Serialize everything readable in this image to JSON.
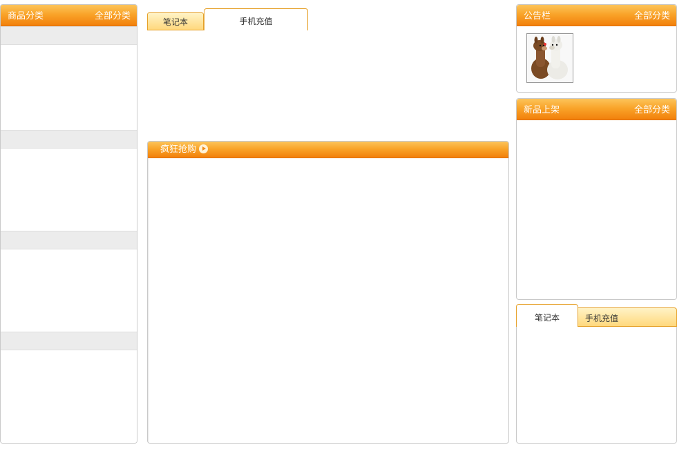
{
  "sidebar": {
    "title": "商品分类",
    "more": "全部分类",
    "category_sections": 4
  },
  "top_tabs": {
    "tab1": "笔记本",
    "tab2": "手机充值",
    "active": "手机充值"
  },
  "flash_sale": {
    "title": "疯狂抢购",
    "arrow_icon": "circle-arrow-right-icon"
  },
  "notice": {
    "title": "公告栏",
    "more": "全部分类",
    "image": "alpaca-plush-photo"
  },
  "new_items": {
    "title": "新品上架",
    "more": "全部分类"
  },
  "bottom_tabs": {
    "tab1": "笔记本",
    "tab2": "手机充值",
    "active": "笔记本"
  },
  "colors": {
    "header_orange": "#f9a42a",
    "tab_border": "#e6a22c",
    "category_bar": "#ececec"
  }
}
